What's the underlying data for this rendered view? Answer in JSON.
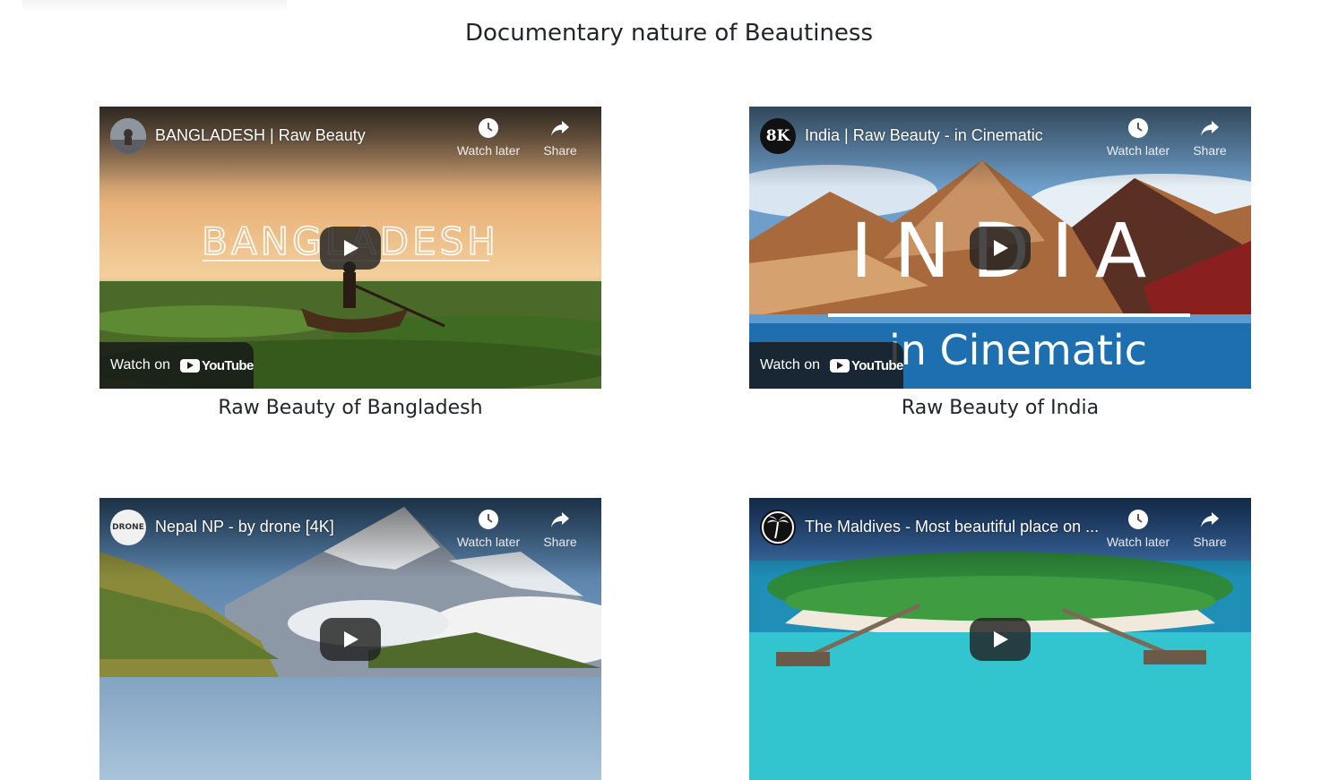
{
  "page": {
    "title": "Documentary nature of Beautiness"
  },
  "actions": {
    "watch_later": "Watch later",
    "share": "Share",
    "watch_on": "Watch on",
    "youtube": "YouTube"
  },
  "videos": [
    {
      "title": "BANGLADESH | Raw Beauty",
      "caption": "Raw Beauty of Bangladesh",
      "overlay_text": "BANGLADESH",
      "avatar": "",
      "thumb_colors": [
        "#e8a765",
        "#2f5a22"
      ]
    },
    {
      "title": "India | Raw Beauty - in Cinematic",
      "caption": "Raw Beauty of India",
      "overlay_text": "INDIA",
      "overlay_sub": "in Cinematic",
      "avatar": "8K",
      "thumb_colors": [
        "#b57a4d",
        "#1c6fa8"
      ]
    },
    {
      "title": "Nepal NP - by drone [4K]",
      "caption": "",
      "overlay_text": "",
      "avatar": "DRONE",
      "thumb_colors": [
        "#7a8fa8",
        "#5c7a32"
      ]
    },
    {
      "title": "The Maldives - Most beautiful place on ...",
      "caption": "",
      "overlay_text": "",
      "avatar": "palm-tree-icon",
      "thumb_colors": [
        "#2d7fa8",
        "#2fb8c6"
      ]
    }
  ]
}
